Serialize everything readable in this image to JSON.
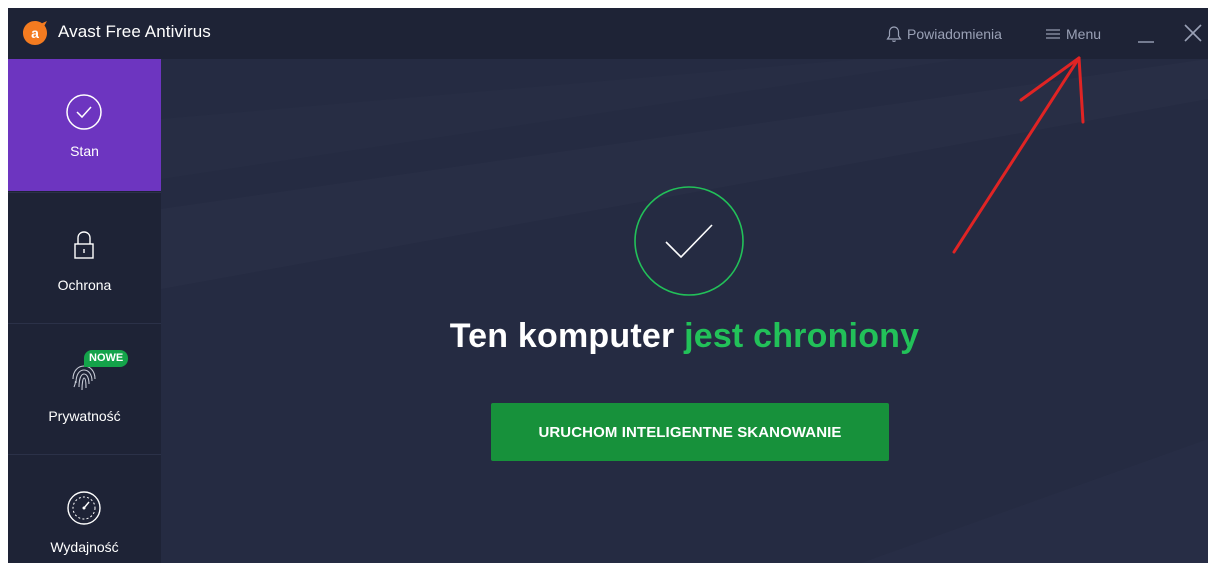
{
  "window": {
    "title": "Avast Free Antivirus",
    "notifications_label": "Powiadomienia",
    "menu_label": "Menu"
  },
  "sidebar": {
    "items": [
      {
        "label": "Stan",
        "icon": "check-circle-icon",
        "active": true
      },
      {
        "label": "Ochrona",
        "icon": "lock-icon",
        "active": false
      },
      {
        "label": "Prywatność",
        "icon": "fingerprint-icon",
        "active": false,
        "badge": "NOWE"
      },
      {
        "label": "Wydajność",
        "icon": "speedometer-icon",
        "active": false
      }
    ]
  },
  "main": {
    "status_icon": "check-circle-icon",
    "headline_part1": "Ten komputer ",
    "headline_part2": "jest chroniony",
    "scan_button_label": "URUCHOM INTELIGENTNE SKANOWANIE"
  },
  "colors": {
    "background": "#232940",
    "titlebar": "#1e2336",
    "sidebar_active": "#6d35c0",
    "accent_green": "#22c159",
    "button_green": "#17913b",
    "logo_orange": "#f47b20",
    "annotation_red": "#e02424"
  }
}
